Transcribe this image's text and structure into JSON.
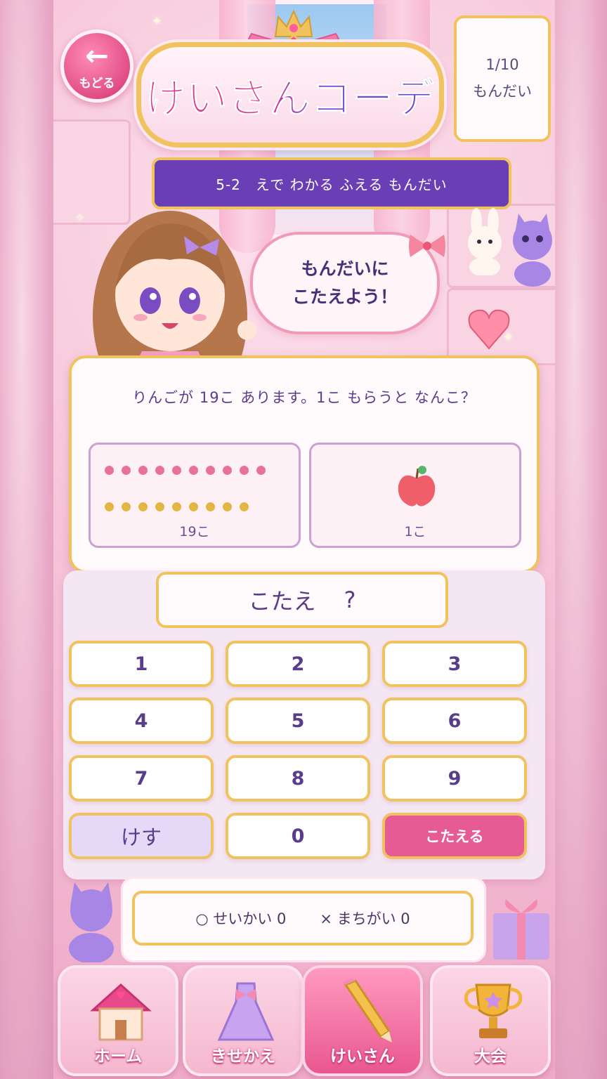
{
  "header": {
    "back_label": "もどる",
    "title": "けいさんコーデ",
    "progress_fraction": "1/10",
    "progress_unit": "もんだい"
  },
  "lesson": {
    "label": "5-2　えで わかる ふえる もんだい"
  },
  "speech": {
    "line1": "もんだいに",
    "line2": "こたえよう！"
  },
  "question": {
    "text": "りんごが 19こ あります。1こ もらうと なんこ？",
    "left_panel": {
      "label": "19こ",
      "pink_dots": 10,
      "gold_dots": 9
    },
    "right_panel": {
      "label": "1こ",
      "icon": "apple-icon"
    }
  },
  "answer": {
    "label": "こたえ",
    "value": "?"
  },
  "keypad": {
    "keys": [
      "1",
      "2",
      "3",
      "4",
      "5",
      "6",
      "7",
      "8",
      "9"
    ],
    "clear": "けす",
    "zero": "0",
    "submit": "こたえる"
  },
  "score": {
    "correct": "○ せいかい 0",
    "wrong": "× まちがい 0"
  },
  "nav": {
    "items": [
      {
        "label": "ホーム",
        "icon": "house-icon",
        "active": false
      },
      {
        "label": "きせかえ",
        "icon": "dress-icon",
        "active": false
      },
      {
        "label": "けいさん",
        "icon": "pencil-icon",
        "active": true
      },
      {
        "label": "大会",
        "icon": "trophy-icon",
        "active": false
      }
    ]
  },
  "colors": {
    "accent_pink": "#e75b95",
    "accent_purple": "#6a3fb5",
    "gold_border": "#f1c35e",
    "text_purple": "#5a3d8a"
  }
}
